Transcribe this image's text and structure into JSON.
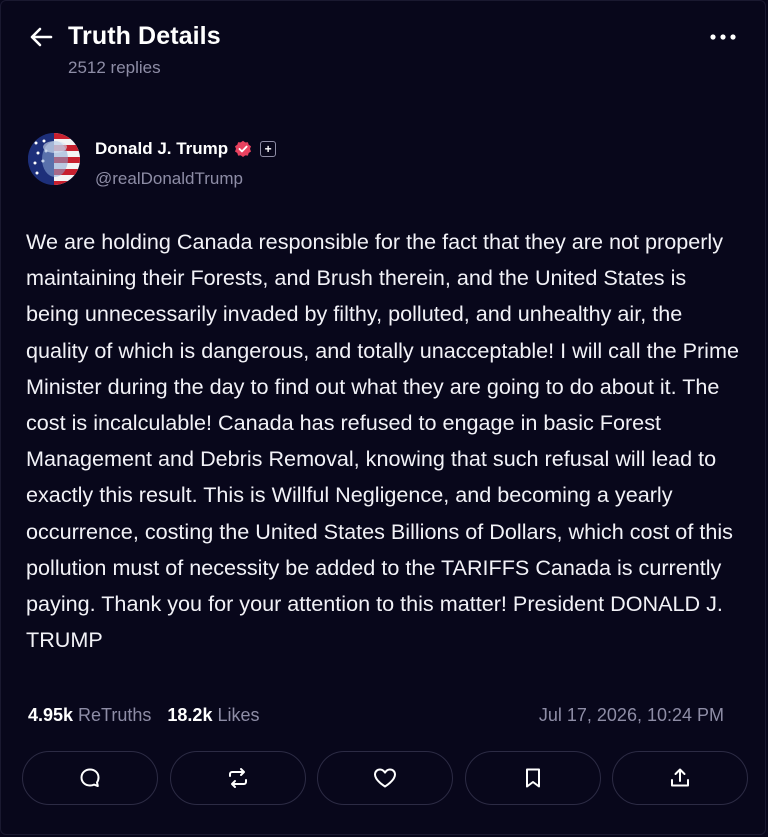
{
  "header": {
    "title": "Truth Details",
    "replies": "2512 replies",
    "back_icon": "arrow-left-icon",
    "more_icon": "more-horizontal-icon"
  },
  "author": {
    "name": "Donald J. Trump",
    "handle": "@realDonaldTrump",
    "verified_icon": "verified-badge-icon",
    "plus_badge": "+"
  },
  "post": {
    "text": "We are holding Canada responsible for the fact that they are not properly maintaining their Forests, and Brush therein, and the United States is being unnecessarily invaded by filthy, polluted, and unhealthy air, the quality of which is dangerous, and totally unacceptable! I will call the Prime Minister during the day to find out what they are going to do about it. The cost is incalculable! Canada has refused to engage in basic Forest Management and Debris Removal, knowing that such refusal will lead to exactly this result. This is Willful Negligence, and becoming a yearly occurrence, costing the United States Billions of Dollars, which cost of this pollution must of necessity be added to the TARIFFS Canada is currently paying. Thank you for your attention to this matter! President DONALD J. TRUMP"
  },
  "stats": {
    "retruths_count": "4.95k",
    "retruths_label": "ReTruths",
    "likes_count": "18.2k",
    "likes_label": "Likes",
    "timestamp": "Jul 17, 2026, 10:24 PM"
  },
  "actions": [
    {
      "icon": "reply-icon"
    },
    {
      "icon": "retruth-icon"
    },
    {
      "icon": "heart-icon"
    },
    {
      "icon": "bookmark-icon"
    },
    {
      "icon": "share-icon"
    }
  ],
  "colors": {
    "background": "#08071b",
    "muted_text": "#8e8da6",
    "button_border": "#2c2b44",
    "verified_badge": "#e8415f"
  }
}
